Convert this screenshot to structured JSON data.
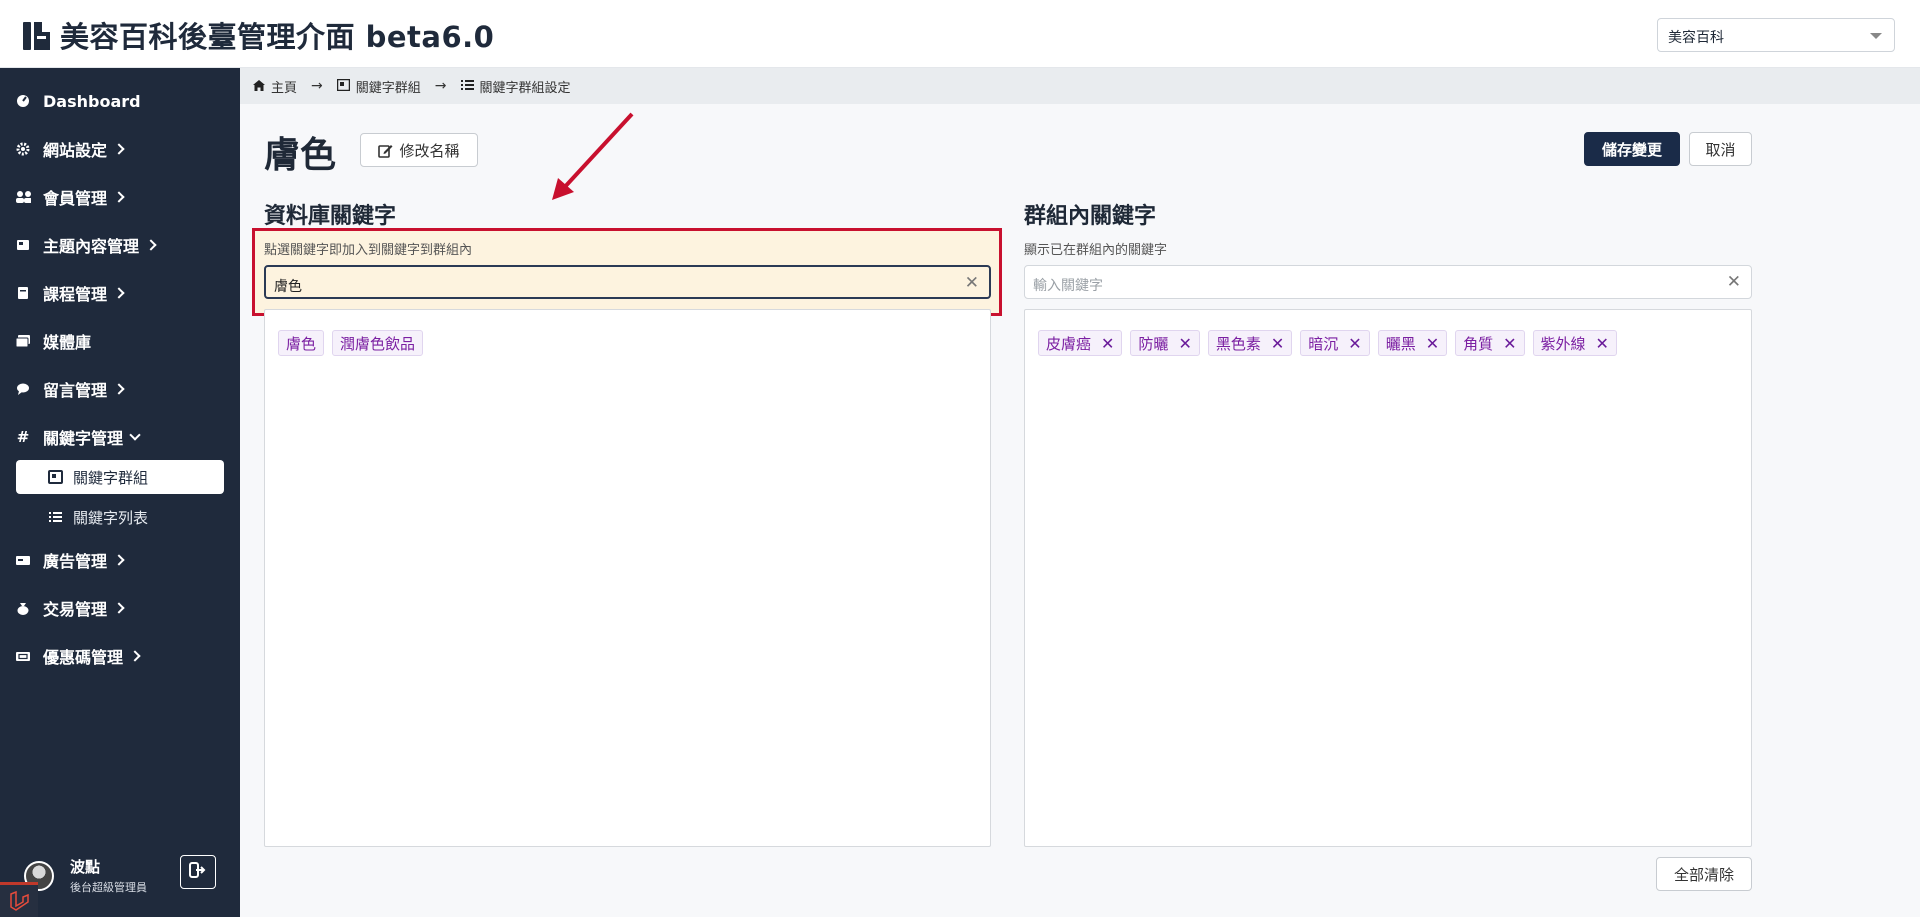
{
  "header": {
    "title": "美容百科後臺管理介面 beta6.0",
    "site_select": "美容百科"
  },
  "sidebar": {
    "items": [
      {
        "label": "Dashboard",
        "icon": "dashboard-icon"
      },
      {
        "label": "網站設定",
        "icon": "gear-icon"
      },
      {
        "label": "會員管理",
        "icon": "users-icon"
      },
      {
        "label": "主題內容管理",
        "icon": "content-icon"
      },
      {
        "label": "課程管理",
        "icon": "book-icon"
      },
      {
        "label": "媒體庫",
        "icon": "images-icon"
      },
      {
        "label": "留言管理",
        "icon": "comment-icon"
      },
      {
        "label": "關鍵字管理",
        "icon": "hash-icon"
      },
      {
        "label": "廣告管理",
        "icon": "ad-icon"
      },
      {
        "label": "交易管理",
        "icon": "money-bag-icon"
      },
      {
        "label": "優惠碼管理",
        "icon": "ticket-icon"
      }
    ],
    "sub_items": [
      {
        "label": "關鍵字群組"
      },
      {
        "label": "關鍵字列表"
      }
    ],
    "user": {
      "name": "波點",
      "role": "後台超級管理員"
    }
  },
  "breadcrumb": {
    "home": "主頁",
    "group": "關鍵字群組",
    "settings": "關鍵字群組設定"
  },
  "page": {
    "title": "膚色",
    "rename_label": "修改名稱",
    "save_label": "儲存變更",
    "cancel_label": "取消",
    "clear_all_label": "全部清除"
  },
  "db_keywords": {
    "title": "資料庫關鍵字",
    "hint": "點選關鍵字即加入到關鍵字到群組內",
    "search_value": "膚色",
    "results": [
      "膚色",
      "潤膚色飲品"
    ]
  },
  "group_keywords": {
    "title": "群組內關鍵字",
    "hint": "顯示已在群組內的關鍵字",
    "search_placeholder": "輸入關鍵字",
    "items": [
      "皮膚癌",
      "防曬",
      "黑色素",
      "暗沉",
      "曬黑",
      "角質",
      "紫外線"
    ]
  },
  "colors": {
    "sidebar_bg": "#1f2a3c",
    "primary": "#1a2b48",
    "tag_text": "#7b1fa2",
    "highlight": "#c8102e"
  }
}
